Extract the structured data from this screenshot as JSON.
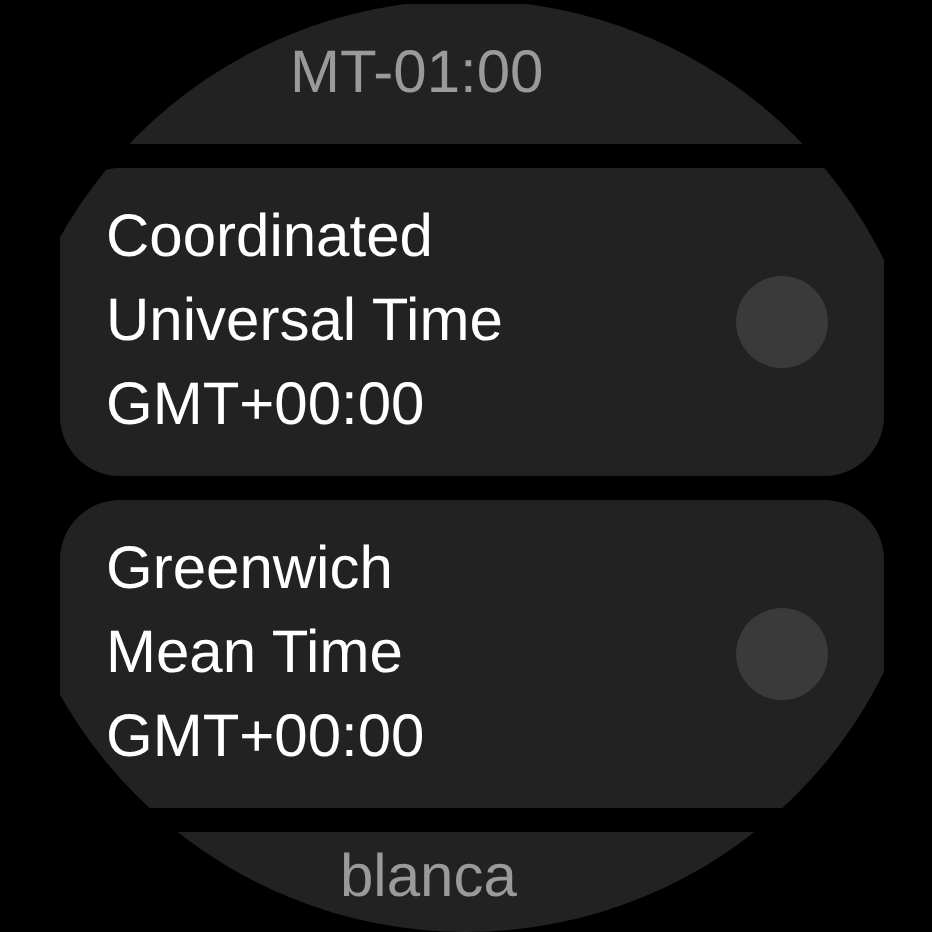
{
  "time_zones": [
    {
      "lines": [
        "MT-01:00"
      ],
      "dimmed": true
    },
    {
      "lines": [
        "Coordinated",
        "Universal Time",
        "GMT+00:00"
      ],
      "dimmed": false,
      "checked": false
    },
    {
      "lines": [
        "Greenwich",
        "Mean Time",
        "GMT+00:00"
      ],
      "dimmed": false,
      "checked": false
    },
    {
      "lines": [
        "blanca"
      ],
      "dimmed": true
    }
  ]
}
